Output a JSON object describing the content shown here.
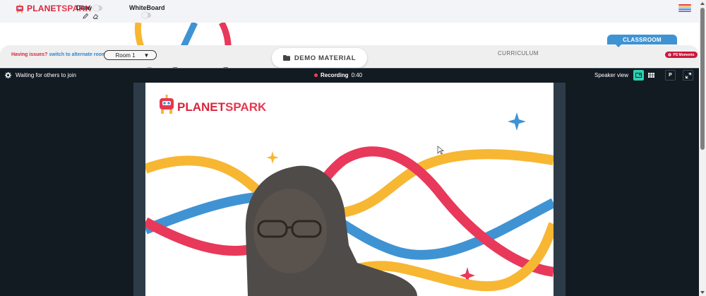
{
  "app": {
    "logo_text_a": "PLANET",
    "logo_text_b": "SPARK"
  },
  "toolbar": {
    "draw_label": "Draw",
    "whiteboard_label": "WhiteBoard",
    "draw_on": false,
    "whiteboard_on": false
  },
  "classroom": {
    "issue_prefix": "Having issues?",
    "issue_link": "switch to alternate room",
    "room_value": "Room 1",
    "demo_material_label": "DEMO MATERIAL",
    "curriculum_label": "CURRICULUM",
    "classroom_tab_label": "CLASSROOM",
    "ps_moments_label": "PS Moments"
  },
  "video": {
    "status_text": "Waiting for others to join",
    "recording_label": "Recording",
    "recording_time": "0:40",
    "view_label": "Speaker view",
    "pin_label": "P"
  },
  "slide": {
    "logo_text_a": "PLANET",
    "logo_text_b": "SPARK"
  },
  "colors": {
    "brand_red": "#d7263d",
    "brand_pink": "#e6374f",
    "accent_blue": "#3f93d3",
    "wave_yellow": "#f7b733",
    "wave_blue": "#3f93d3",
    "wave_red": "#e8395a",
    "video_bg": "#121a22",
    "active_view": "#2fd0b2"
  },
  "icons": {
    "menu": "hamburger-icon",
    "pencil": "pencil-icon",
    "eraser": "eraser-icon",
    "folder": "folder-icon",
    "settings": "gear-icon",
    "speaker_view": "speaker-view-icon",
    "gallery_view": "grid-view-icon",
    "fullscreen": "expand-icon"
  }
}
